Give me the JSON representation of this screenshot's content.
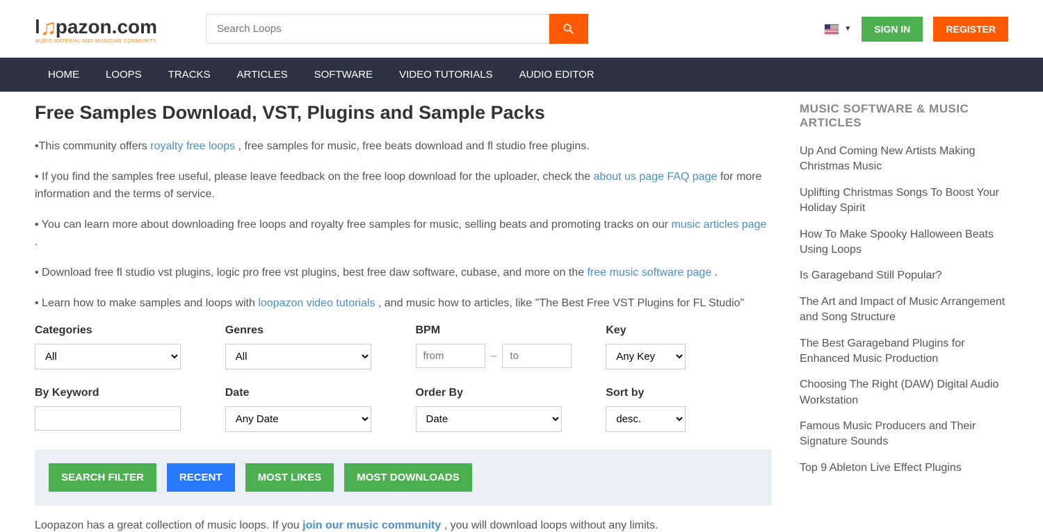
{
  "header": {
    "logo_text": "pazon.com",
    "logo_prefix": "l",
    "logo_tagline": "AUDIO MATERIAL AND MUSICIAN COMMUNITY",
    "search_placeholder": "Search Loops",
    "signin": "SIGN IN",
    "register": "REGISTER"
  },
  "nav": [
    "HOME",
    "LOOPS",
    "TRACKS",
    "ARTICLES",
    "SOFTWARE",
    "VIDEO TUTORIALS",
    "AUDIO EDITOR"
  ],
  "page": {
    "title": "Free Samples Download, VST, Plugins and Sample Packs",
    "intro": {
      "p1_pre": "•This community offers ",
      "p1_link": "royalty free loops",
      "p1_post": ", free samples for music, free beats download and fl studio free plugins.",
      "p2_pre": "• If you find the samples free useful, please leave feedback on the free loop download for the uploader, check the ",
      "p2_link1": "about us page",
      "p2_mid": " ",
      "p2_link2": "FAQ page",
      "p2_post": " for more information and the terms of service.",
      "p3_pre": "• You can learn more about downloading free loops and royalty free samples for music, selling beats and promoting tracks on our ",
      "p3_link": "music articles page",
      "p3_post": ".",
      "p4_pre": "• Download free fl studio vst plugins, logic pro free vst plugins, best free daw software, cubase, and more on the ",
      "p4_link": "free music software page",
      "p4_post": ".",
      "p5_pre": "• Learn how to make samples and loops with ",
      "p5_link": "loopazon video tutorials",
      "p5_post": ", and music how to articles, like \"The Best Free VST Plugins for FL Studio\""
    },
    "filters": {
      "categories": {
        "label": "Categories",
        "value": "All"
      },
      "genres": {
        "label": "Genres",
        "value": "All"
      },
      "bpm": {
        "label": "BPM",
        "from_placeholder": "from",
        "to_placeholder": "to"
      },
      "key": {
        "label": "Key",
        "value": "Any Key"
      },
      "keyword": {
        "label": "By Keyword"
      },
      "date": {
        "label": "Date",
        "value": "Any Date"
      },
      "orderby": {
        "label": "Order By",
        "value": "Date"
      },
      "sortby": {
        "label": "Sort by",
        "value": "desc."
      }
    },
    "buttons": {
      "search_filter": "SEARCH FILTER",
      "recent": "RECENT",
      "most_likes": "MOST LIKES",
      "most_downloads": "MOST DOWNLOADS"
    },
    "collection": {
      "pre": "Loopazon has a great collection of music loops. If you ",
      "link": "join our music community",
      "post": ", you will download loops without any limits."
    }
  },
  "sidebar": {
    "title": "MUSIC SOFTWARE & MUSIC ARTICLES",
    "items": [
      "Up And Coming New Artists Making Christmas Music",
      "Uplifting Christmas Songs To Boost Your Holiday Spirit",
      "How To Make Spooky Halloween Beats Using Loops",
      "Is Garageband Still Popular?",
      "The Art and Impact of Music Arrangement and Song Structure",
      "The Best Garageband Plugins for Enhanced Music Production",
      "Choosing The Right (DAW) Digital Audio Workstation",
      "Famous Music Producers and Their Signature Sounds",
      "Top 9 Ableton Live Effect Plugins"
    ]
  }
}
